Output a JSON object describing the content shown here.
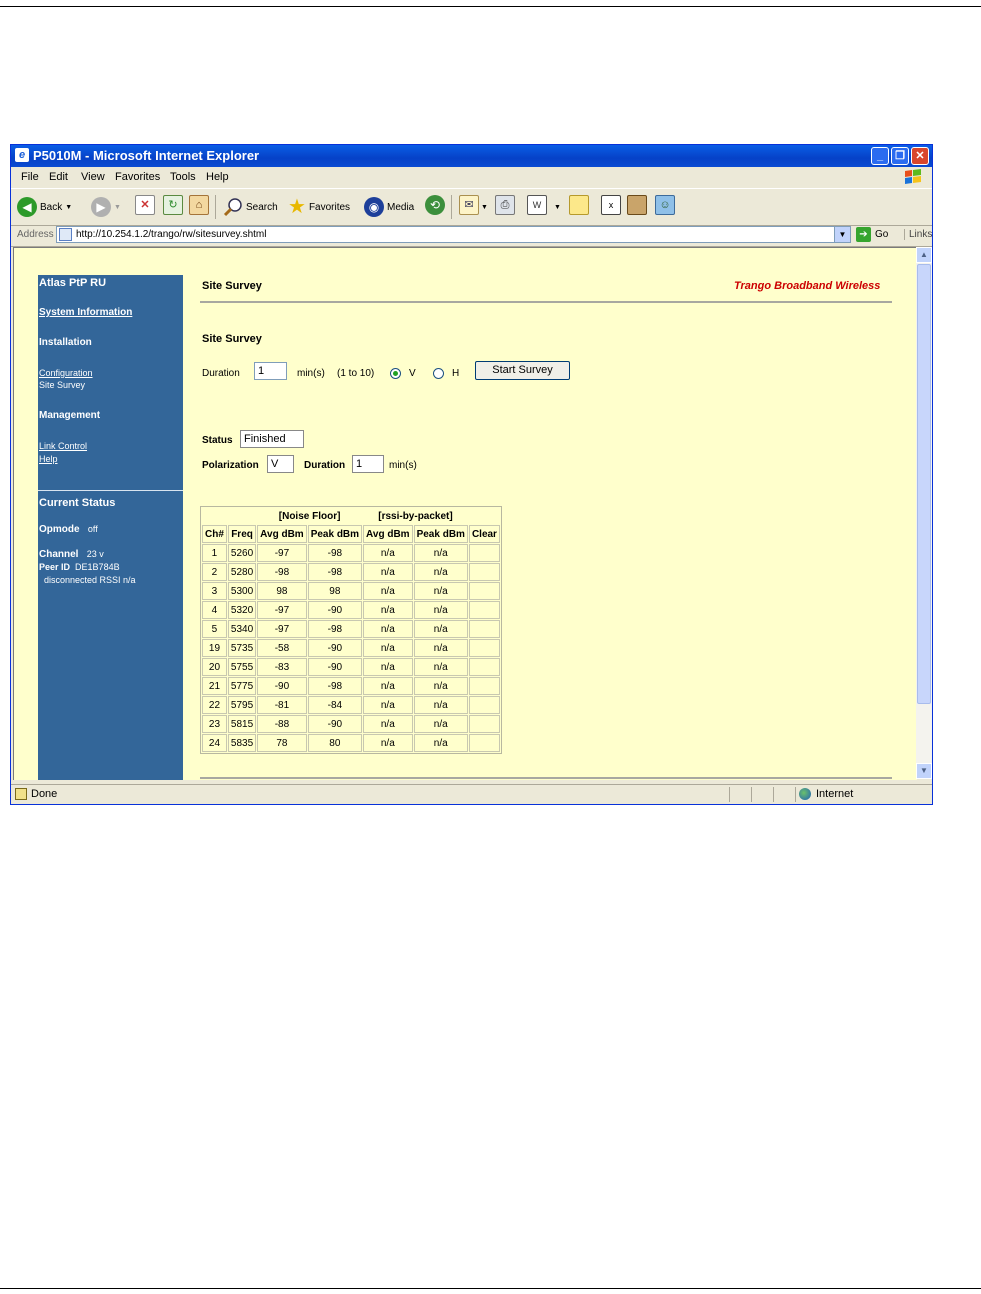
{
  "window": {
    "title": "P5010M - Microsoft Internet Explorer",
    "controls": [
      "_",
      "❐",
      "✕"
    ]
  },
  "menu": [
    "File",
    "Edit",
    "View",
    "Favorites",
    "Tools",
    "Help"
  ],
  "toolbar": {
    "back": "Back",
    "search": "Search",
    "favorites": "Favorites",
    "media": "Media"
  },
  "address": {
    "label": "Address",
    "url": "http://10.254.1.2/trango/rw/sitesurvey.shtml",
    "go": "Go",
    "links": "Links"
  },
  "sidebar": {
    "title": "Atlas PtP RU",
    "system_information": "System Information",
    "installation": "Installation",
    "configuration": "Configuration",
    "site_survey": "Site Survey",
    "management": "Management",
    "link_control": "Link Control",
    "help": "Help",
    "current_status": "Current Status",
    "opmode_label": "Opmode",
    "opmode_value": "off",
    "channel_label": "Channel",
    "channel_value": "23 v",
    "peer_label": "Peer ID",
    "peer_value": "DE1B784B",
    "link_state": "disconnected RSSI n/a"
  },
  "page": {
    "title": "Site Survey",
    "brand": "Trango Broadband Wireless",
    "section_title": "Site Survey"
  },
  "form": {
    "duration_label": "Duration",
    "duration_value": "1",
    "duration_unit": "min(s)",
    "range": "(1 to 10)",
    "pol_v": "V",
    "pol_h": "H",
    "selected_pol": "V",
    "start_button": "Start Survey"
  },
  "status": {
    "status_label": "Status",
    "status_value": "Finished",
    "polarization_label": "Polarization",
    "polarization_value": "V",
    "duration_label": "Duration",
    "duration_value": "1",
    "duration_unit": "min(s)"
  },
  "table": {
    "group_headers": [
      "[Noise Floor]",
      "[rssi-by-packet]"
    ],
    "columns": [
      "Ch#",
      "Freq",
      "Avg dBm",
      "Peak dBm",
      "Avg dBm",
      "Peak dBm",
      "Clear"
    ],
    "rows": [
      [
        "1",
        "5260",
        "-97",
        "-98",
        "n/a",
        "n/a",
        ""
      ],
      [
        "2",
        "5280",
        "-98",
        "-98",
        "n/a",
        "n/a",
        ""
      ],
      [
        "3",
        "5300",
        "98",
        "98",
        "n/a",
        "n/a",
        ""
      ],
      [
        "4",
        "5320",
        "-97",
        "-90",
        "n/a",
        "n/a",
        ""
      ],
      [
        "5",
        "5340",
        "-97",
        "-98",
        "n/a",
        "n/a",
        ""
      ],
      [
        "19",
        "5735",
        "-58",
        "-90",
        "n/a",
        "n/a",
        ""
      ],
      [
        "20",
        "5755",
        "-83",
        "-90",
        "n/a",
        "n/a",
        ""
      ],
      [
        "21",
        "5775",
        "-90",
        "-98",
        "n/a",
        "n/a",
        ""
      ],
      [
        "22",
        "5795",
        "-81",
        "-84",
        "n/a",
        "n/a",
        ""
      ],
      [
        "23",
        "5815",
        "-88",
        "-90",
        "n/a",
        "n/a",
        ""
      ],
      [
        "24",
        "5835",
        "78",
        "80",
        "n/a",
        "n/a",
        ""
      ]
    ]
  },
  "statusbar": {
    "left": "Done",
    "zone": "Internet"
  }
}
